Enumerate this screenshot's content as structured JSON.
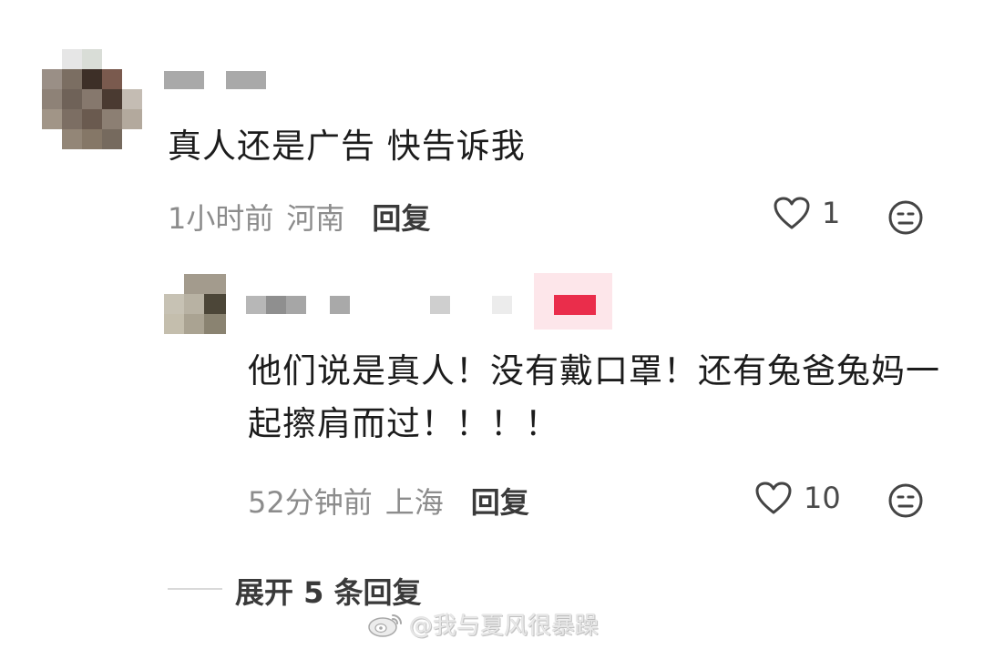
{
  "comment": {
    "text": "真人还是广告 快告诉我",
    "time": "1小时前",
    "location": "河南",
    "reply_label": "回复",
    "likes": "1"
  },
  "reply": {
    "text": "他们说是真人！没有戴口罩！还有兔爸兔妈一起擦肩而过！！！！",
    "time": "52分钟前",
    "location": "上海",
    "reply_label": "回复",
    "likes": "10"
  },
  "expand": {
    "label": "展开 5 条回复"
  },
  "watermark": {
    "text": "@我与夏风很暴躁"
  },
  "icons": {
    "like": "heart-icon",
    "dislike": "meh-face-icon",
    "watermark_logo": "weibo-logo-icon"
  },
  "colors": {
    "badge": "#ea2d4b",
    "meta_text": "#8c8c8c"
  }
}
